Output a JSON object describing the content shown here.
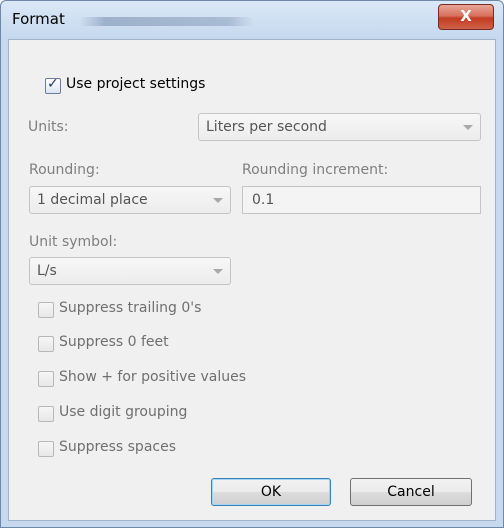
{
  "window": {
    "title": "Format",
    "close_label": "X"
  },
  "use_project_settings": {
    "label": "Use project settings",
    "checked": true
  },
  "units": {
    "label": "Units:",
    "value": "Liters per second"
  },
  "rounding": {
    "label": "Rounding:",
    "value": "1 decimal place"
  },
  "rounding_increment": {
    "label": "Rounding increment:",
    "value": "0.1"
  },
  "unit_symbol": {
    "label": "Unit symbol:",
    "value": "L/s"
  },
  "options": [
    {
      "label": "Suppress trailing 0's",
      "checked": false
    },
    {
      "label": "Suppress 0 feet",
      "checked": false
    },
    {
      "label": "Show + for positive values",
      "checked": false
    },
    {
      "label": "Use digit grouping",
      "checked": false
    },
    {
      "label": "Suppress spaces",
      "checked": false
    }
  ],
  "buttons": {
    "ok": "OK",
    "cancel": "Cancel"
  }
}
